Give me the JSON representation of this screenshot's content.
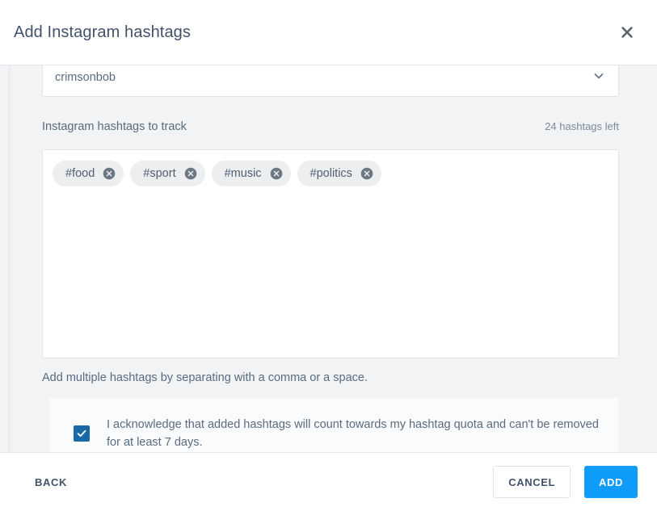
{
  "dialog": {
    "title": "Add Instagram hashtags",
    "close_icon": "close-icon"
  },
  "account_select": {
    "value": "crimsonbob",
    "chevron_icon": "chevron-down-icon"
  },
  "hashtag_field": {
    "label": "Instagram hashtags to track",
    "quota": "24 hashtags left",
    "chips": [
      {
        "label": "#food",
        "remove_icon": "remove-circle-icon"
      },
      {
        "label": "#sport",
        "remove_icon": "remove-circle-icon"
      },
      {
        "label": "#music",
        "remove_icon": "remove-circle-icon"
      },
      {
        "label": "#politics",
        "remove_icon": "remove-circle-icon"
      }
    ],
    "helper": "Add multiple hashtags by separating with a comma or a space."
  },
  "acknowledgment": {
    "checked": true,
    "check_icon": "check-icon",
    "text": "I acknowledge that added hashtags will count towards my hashtag quota and can't be removed for at least 7 days."
  },
  "footer": {
    "back_label": "BACK",
    "cancel_label": "CANCEL",
    "add_label": "ADD"
  },
  "colors": {
    "accent_blue": "#109cfb",
    "checkbox_blue": "#1769a8",
    "text_primary": "#42526b",
    "text_secondary": "#5b6b7f",
    "text_muted": "#7b8a9c",
    "body_bg": "#f1f3f5",
    "chip_bg": "#eceef0",
    "border": "#e0e4e8"
  }
}
